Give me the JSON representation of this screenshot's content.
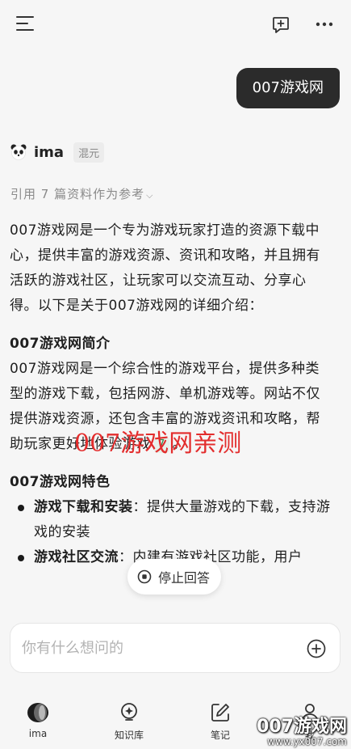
{
  "user_message": "007游戏网",
  "bot": {
    "name": "ima",
    "model": "混元"
  },
  "refs_label": "引用 7 篇资料作为参考",
  "answer": {
    "intro": "007游戏网是一个专为游戏玩家打造的资源下载中心，提供丰富的游戏资源、资讯和攻略，并且拥有活跃的游戏社区，让玩家可以交流互动、分享心得。以下是关于007游戏网的详细介绍：",
    "section1_title": "007游戏网简介",
    "section1_body": "007游戏网是一个综合性的游戏平台，提供多种类型的游戏下载，包括网游、单机游戏等。网站不仅提供游戏资源，还包含丰富的游戏资讯和攻略，帮助玩家更好地体验游戏",
    "section1_cite": "7",
    "section1_end": "。",
    "section2_title": "007游戏网特色",
    "bullets": [
      {
        "title": "游戏下载和安装",
        "text": "：提供大量游戏的下载，支持游戏的安装"
      },
      {
        "title": "游戏社区交流",
        "text": "：内建有游戏社区功能，用户"
      }
    ]
  },
  "overlay_watermark": "007游戏网亲测",
  "stop_button": "停止回答",
  "input": {
    "placeholder": "你有什么想问的"
  },
  "tabs": {
    "ima": "ima",
    "knowledge": "知识库",
    "notes": "笔记",
    "me": "我"
  },
  "corner_watermark": {
    "name": "007游戏网",
    "url": "www.yx007.com"
  },
  "colors": {
    "bubble": "#2b2b2b",
    "accent_green": "#2f8a4c",
    "watermark_red": "#e32d2d"
  }
}
